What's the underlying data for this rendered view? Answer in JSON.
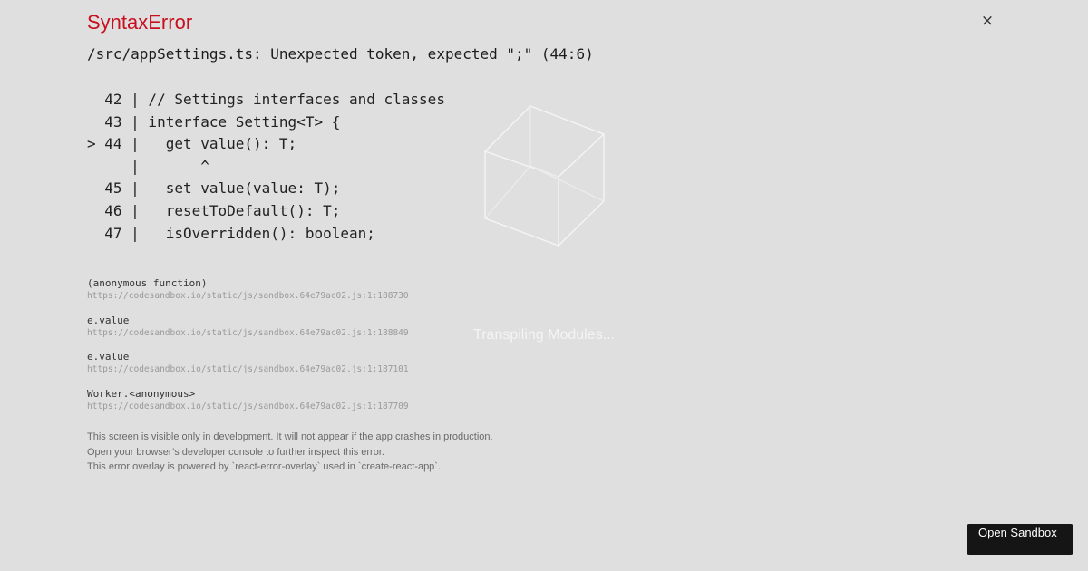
{
  "error": {
    "title": "SyntaxError",
    "close_label": "×",
    "message": "/src/appSettings.ts: Unexpected token, expected \";\" (44:6)"
  },
  "code_frame": {
    "lines": [
      "  42 | // Settings interfaces and classes",
      "  43 | interface Setting<T> {",
      "> 44 |   get value(): T;",
      "     |       ^",
      "  45 |   set value(value: T);",
      "  46 |   resetToDefault(): T;",
      "  47 |   isOverridden(): boolean;"
    ],
    "highlighted_line": 44
  },
  "stack": [
    {
      "fn": "(anonymous function)",
      "loc": "https://codesandbox.io/static/js/sandbox.64e79ac02.js:1:188730"
    },
    {
      "fn": "e.value",
      "loc": "https://codesandbox.io/static/js/sandbox.64e79ac02.js:1:188849"
    },
    {
      "fn": "e.value",
      "loc": "https://codesandbox.io/static/js/sandbox.64e79ac02.js:1:187101"
    },
    {
      "fn": "Worker.<anonymous>",
      "loc": "https://codesandbox.io/static/js/sandbox.64e79ac02.js:1:187709"
    }
  ],
  "footer": {
    "lines": [
      "This screen is visible only in development. It will not appear if the app crashes in production.",
      "Open your browser’s developer console to further inspect this error.",
      "This error overlay is powered by `react-error-overlay` used in `create-react-app`."
    ]
  },
  "loader": {
    "icon": "cube-outline-icon",
    "text": "Transpiling Modules..."
  },
  "open_sandbox": {
    "label": "Open Sandbox"
  },
  "colors": {
    "background": "#dfdfdf",
    "error_title": "#c80f1e",
    "button_bg": "#151515"
  }
}
